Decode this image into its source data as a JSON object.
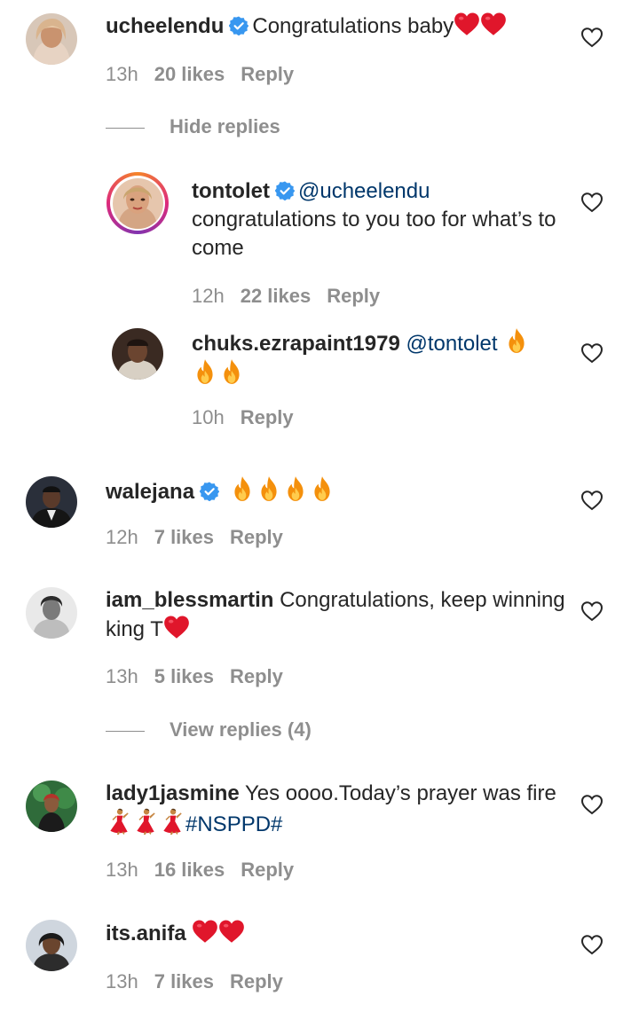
{
  "comments": [
    {
      "username": "ucheelendu",
      "text": "Congratulations baby",
      "time": "13h",
      "likes": "20 likes",
      "reply": "Reply"
    },
    {
      "username": "walejana",
      "text": "",
      "time": "12h",
      "likes": "7 likes",
      "reply": "Reply"
    },
    {
      "username": "iam_blessmartin",
      "text": "Congratulations, keep winning king T",
      "time": "13h",
      "likes": "5 likes",
      "reply": "Reply"
    },
    {
      "username": "lady1jasmine",
      "text": "Yes oooo.Today’s prayer was fire",
      "hashtag": "#NSPPD#",
      "time": "13h",
      "likes": "16 likes",
      "reply": "Reply"
    },
    {
      "username": "its.anifa",
      "text": "",
      "time": "13h",
      "likes": "7 likes",
      "reply": "Reply"
    }
  ],
  "replies": [
    {
      "username": "tontolet",
      "mention": "@ucheelendu",
      "text": "congratulations to you too for what’s to come",
      "time": "12h",
      "likes": "22 likes",
      "reply": "Reply"
    },
    {
      "username": "chuks.ezrapaint1979",
      "mention": "@tontolet",
      "time": "10h",
      "reply": "Reply"
    }
  ],
  "toggles": {
    "hide_replies": "Hide replies",
    "view_replies": "View replies (4)"
  },
  "colors": {
    "text": "#262626",
    "secondary": "#8e8e8e",
    "link": "#00376b",
    "verified": "#3897f0",
    "heart_emoji": "#e0162b"
  }
}
